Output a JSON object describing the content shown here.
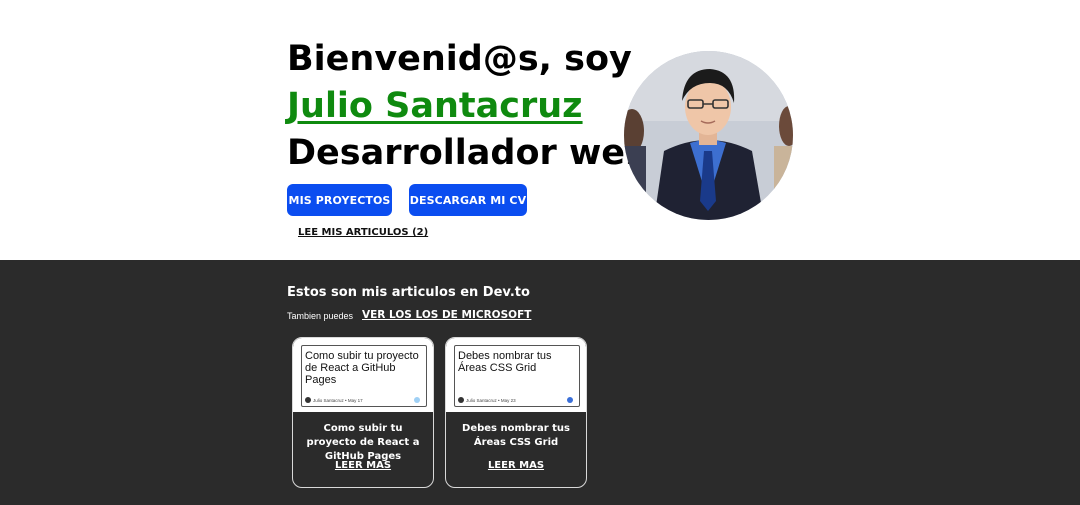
{
  "hero": {
    "greeting": "Bienvenid@s, soy",
    "name": "Julio Santacruz",
    "role": "Desarrollador web",
    "btn_projects": "MIS PROYECTOS",
    "btn_cv": "DESCARGAR MI CV",
    "articles_link": "LEE MIS ARTICULOS (2)"
  },
  "articles": {
    "title": "Estos son mis articulos en Dev.to",
    "also_text": "Tambien puedes",
    "ms_link": "VER LOS LOS DE MICROSOFT",
    "cards": [
      {
        "thumb_title": "Como subir tu proyecto de React a GitHub Pages",
        "thumb_meta": "Julio Santacruz • May 17",
        "title": "Como subir tu proyecto de React a GitHub Pages",
        "read_more": "LEER MAS",
        "badge_color": "#9fd0f5"
      },
      {
        "thumb_title": "Debes nombrar tus Áreas CSS Grid",
        "thumb_meta": "Julio Santacruz • May 23",
        "title": "Debes nombrar tus Áreas CSS Grid",
        "read_more": "LEER MAS",
        "badge_color": "#3a6fd8"
      }
    ]
  },
  "colors": {
    "accent_green": "#0f8a0f",
    "button_blue": "#0b4df0",
    "section_bg": "#2b2b2b"
  }
}
